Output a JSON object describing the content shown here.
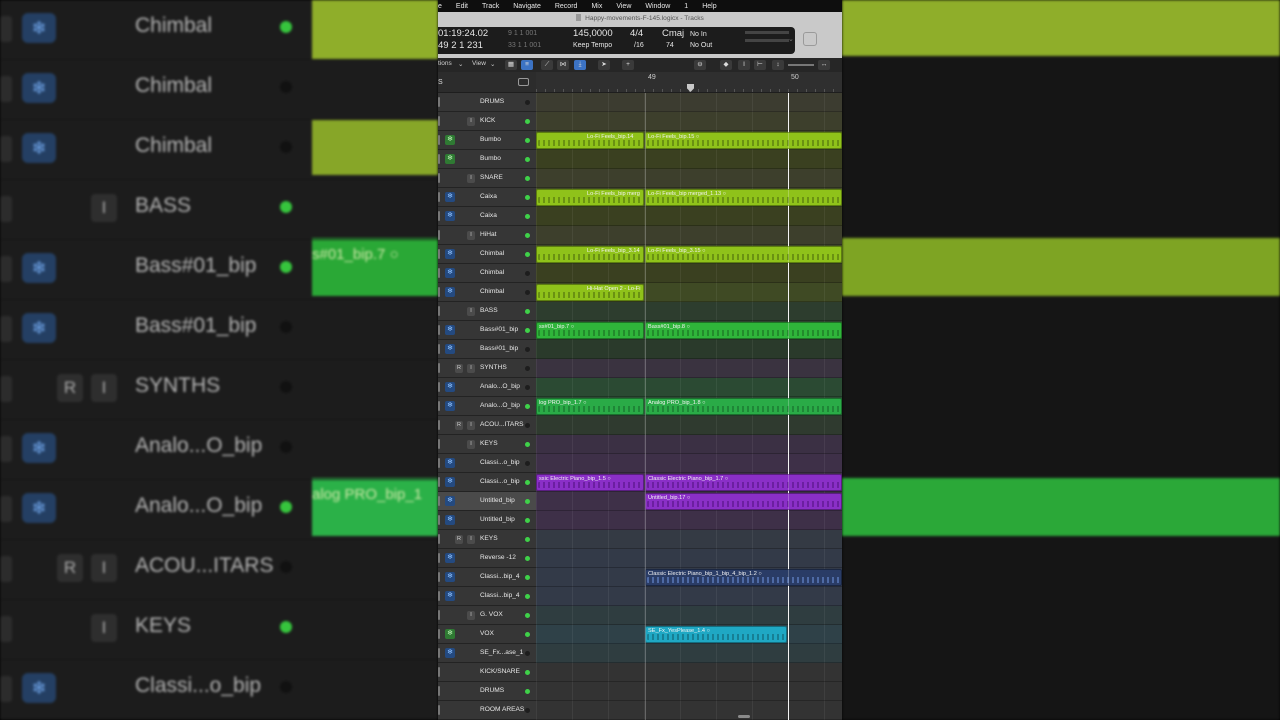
{
  "menubar": {
    "items": [
      "e",
      "Edit",
      "Track",
      "Navigate",
      "Record",
      "Mix",
      "View",
      "Window",
      "1",
      "Help"
    ]
  },
  "window": {
    "title": "Happy-movements-F-145.logicx - Tracks"
  },
  "lcd": {
    "time": "01:19:24.02",
    "time_sub": "9  1  1  001",
    "bars": "49  2  1  231",
    "bars_sub": "33  1  1  001",
    "tempo": "145,0000",
    "tempo_mode": "Keep Tempo",
    "signature": "4/4",
    "division": "/16",
    "key": "Cmaj",
    "key_value": "74",
    "input": "No In",
    "output": "No Out"
  },
  "toolbar": {
    "options_label": "tions",
    "view_label": "View"
  },
  "header": {
    "label": "S"
  },
  "ruler": {
    "bar1": "49",
    "bar2": "50"
  },
  "colors": {
    "lime": "#8fc21a",
    "green": "#2fb53a",
    "purple": "#8a2fc7",
    "navy": "#2a3c66",
    "cyan": "#1fa8c4"
  },
  "tracks": [
    {
      "name": "DRUMS",
      "type": "folder",
      "snow": false,
      "r": false,
      "i": false,
      "led": false
    },
    {
      "name": "KICK",
      "type": "folder",
      "snow": false,
      "r": false,
      "i": true,
      "led": true
    },
    {
      "name": "Bumbo",
      "type": "audio",
      "snow": "green",
      "r": false,
      "i": false,
      "led": true
    },
    {
      "name": "Bumbo",
      "type": "audio",
      "snow": "green",
      "r": false,
      "i": false,
      "led": true
    },
    {
      "name": "SNARE",
      "type": "folder",
      "snow": false,
      "r": false,
      "i": true,
      "led": true
    },
    {
      "name": "Caixa",
      "type": "audio",
      "snow": "blue",
      "r": false,
      "i": false,
      "led": true
    },
    {
      "name": "Caixa",
      "type": "audio",
      "snow": "blue",
      "r": false,
      "i": false,
      "led": true
    },
    {
      "name": "HiHat",
      "type": "folder",
      "snow": false,
      "r": false,
      "i": true,
      "led": true
    },
    {
      "name": "Chimbal",
      "type": "audio",
      "snow": "blue",
      "r": false,
      "i": false,
      "led": true
    },
    {
      "name": "Chimbal",
      "type": "audio",
      "snow": "blue",
      "r": false,
      "i": false,
      "led": false
    },
    {
      "name": "Chimbal",
      "type": "audio",
      "snow": "blue",
      "r": false,
      "i": false,
      "led": false
    },
    {
      "name": "BASS",
      "type": "folder",
      "snow": false,
      "r": false,
      "i": true,
      "led": true
    },
    {
      "name": "Bass#01_bip",
      "type": "audio",
      "snow": "blue",
      "r": false,
      "i": false,
      "led": true
    },
    {
      "name": "Bass#01_bip",
      "type": "audio",
      "snow": "blue",
      "r": false,
      "i": false,
      "led": false
    },
    {
      "name": "SYNTHS",
      "type": "folder",
      "snow": false,
      "r": true,
      "i": true,
      "led": false
    },
    {
      "name": "Analo...O_bip",
      "type": "audio",
      "snow": "blue",
      "r": false,
      "i": false,
      "led": false
    },
    {
      "name": "Analo...O_bip",
      "type": "audio",
      "snow": "blue",
      "r": false,
      "i": false,
      "led": true
    },
    {
      "name": "ACOU...ITARS",
      "type": "folder",
      "snow": false,
      "r": true,
      "i": true,
      "led": false
    },
    {
      "name": "KEYS",
      "type": "folder",
      "snow": false,
      "r": false,
      "i": true,
      "led": true
    },
    {
      "name": "Classi...o_bip",
      "type": "audio",
      "snow": "blue",
      "r": false,
      "i": false,
      "led": false
    },
    {
      "name": "Classi...o_bip",
      "type": "audio",
      "snow": "blue",
      "r": false,
      "i": false,
      "led": true
    },
    {
      "name": "Untitled_bip",
      "type": "audio",
      "snow": "blue",
      "r": false,
      "i": false,
      "led": true,
      "selected": true
    },
    {
      "name": "Untitled_bip",
      "type": "audio",
      "snow": "blue",
      "r": false,
      "i": false,
      "led": true
    },
    {
      "name": "KEYS",
      "type": "folder",
      "snow": false,
      "r": true,
      "i": true,
      "led": true
    },
    {
      "name": "Reverse -12",
      "type": "audio",
      "snow": "blue",
      "r": false,
      "i": false,
      "led": true
    },
    {
      "name": "Classi...bip_4",
      "type": "audio",
      "snow": "blue",
      "r": false,
      "i": false,
      "led": true
    },
    {
      "name": "Classi...bip_4",
      "type": "audio",
      "snow": "blue",
      "r": false,
      "i": false,
      "led": true
    },
    {
      "name": "G. VOX",
      "type": "folder",
      "snow": false,
      "r": false,
      "i": true,
      "led": true
    },
    {
      "name": "VOX",
      "type": "audio",
      "snow": "green",
      "r": false,
      "i": false,
      "led": true
    },
    {
      "name": "SE_Fx...ase_1",
      "type": "audio",
      "snow": "blue",
      "r": false,
      "i": false,
      "led": false
    },
    {
      "name": "KICK/SNARE",
      "type": "folder",
      "snow": false,
      "r": false,
      "i": false,
      "led": true
    },
    {
      "name": "DRUMS",
      "type": "folder",
      "snow": false,
      "r": false,
      "i": false,
      "led": true
    },
    {
      "name": "ROOM AREAS",
      "type": "folder",
      "snow": false,
      "r": false,
      "i": false,
      "led": false
    }
  ],
  "lanes": [
    "#3c3c30",
    "#3d3f2c",
    "#3f4a24",
    "#3a4020",
    "#3d3f2c",
    "#3f4a24",
    "#3a4020",
    "#3d3f2c",
    "#3f4a24",
    "#3a4020",
    "#3f4a24",
    "#2d3d2e",
    "#2d452e",
    "#2a3a2b",
    "#3a3340",
    "#2b4a33",
    "#2b4a33",
    "#2f3a2f",
    "#3b3044",
    "#3e3048",
    "#3e3048",
    "#3e3048",
    "#3e3048",
    "#343a44",
    "#333a48",
    "#333a48",
    "#333a48",
    "#2f3d40",
    "#2f4148",
    "#2f3d40",
    "#333",
    "#333",
    "#333"
  ],
  "regions": [
    {
      "row": 2,
      "start": 0,
      "end": 108,
      "name": "Lo-Fi Feels_bip.14",
      "color": "lime",
      "pad": 50
    },
    {
      "row": 2,
      "start": 109,
      "end": 306,
      "name": "Lo-Fi Feels_bip.15  ○",
      "color": "lime"
    },
    {
      "row": 5,
      "start": 0,
      "end": 108,
      "name": "Lo-Fi Feels_bip merg",
      "color": "lime",
      "pad": 50
    },
    {
      "row": 5,
      "start": 109,
      "end": 306,
      "name": "Lo-Fi Feels_bip merged_1.13  ○",
      "color": "lime"
    },
    {
      "row": 8,
      "start": 0,
      "end": 108,
      "name": "Lo-Fi Feels_bip_3.14",
      "color": "lime",
      "pad": 50
    },
    {
      "row": 8,
      "start": 109,
      "end": 306,
      "name": "Lo-Fi Feels_bip_3.15  ○",
      "color": "lime"
    },
    {
      "row": 10,
      "start": 0,
      "end": 108,
      "name": "Hi-Hat Open 2 - Lo-Fi",
      "color": "lime",
      "pad": 50
    },
    {
      "row": 12,
      "start": 0,
      "end": 108,
      "name": "ss#01_bip.7  ○",
      "color": "green"
    },
    {
      "row": 12,
      "start": 109,
      "end": 306,
      "name": "Bass#01_bip.8  ○",
      "color": "green"
    },
    {
      "row": 16,
      "start": 0,
      "end": 108,
      "name": "log PRO_bip_1.7  ○",
      "color": "green2"
    },
    {
      "row": 16,
      "start": 109,
      "end": 306,
      "name": "Analog PRO_bip_1.8  ○",
      "color": "green2"
    },
    {
      "row": 20,
      "start": 0,
      "end": 108,
      "name": "ssic Electric Piano_bip_1.5  ○",
      "color": "purple"
    },
    {
      "row": 20,
      "start": 109,
      "end": 306,
      "name": "Classic Electric Piano_bip_1.7  ○",
      "color": "purple"
    },
    {
      "row": 21,
      "start": 109,
      "end": 306,
      "name": "Untitled_bip.17  ○",
      "color": "purple"
    },
    {
      "row": 25,
      "start": 109,
      "end": 306,
      "name": "Classic Electric Piano_bip_1_bip_4_bip_1.2  ○",
      "color": "navy"
    },
    {
      "row": 28,
      "start": 109,
      "end": 251,
      "name": "SE_Fx_YesPlease_1.4  ○",
      "color": "cyan"
    }
  ],
  "background_left": {
    "rows": [
      {
        "name": "Chimbal",
        "snow": true,
        "led": true
      },
      {
        "name": "Chimbal",
        "snow": true,
        "led": false
      },
      {
        "name": "Chimbal",
        "snow": true,
        "led": false
      },
      {
        "name": "BASS",
        "snow": false,
        "i": true,
        "led": true
      },
      {
        "name": "Bass#01_bip",
        "snow": true,
        "led": true
      },
      {
        "name": "Bass#01_bip",
        "snow": true,
        "led": false
      },
      {
        "name": "SYNTHS",
        "snow": false,
        "r": true,
        "i": true,
        "led": false
      },
      {
        "name": "Analo...O_bip",
        "snow": true,
        "led": false
      },
      {
        "name": "Analo...O_bip",
        "snow": true,
        "led": true
      },
      {
        "name": "ACOU...ITARS",
        "snow": false,
        "r": true,
        "i": true,
        "led": false
      },
      {
        "name": "KEYS",
        "snow": false,
        "i": true,
        "led": true
      },
      {
        "name": "Classi...o_bip",
        "snow": true,
        "led": false
      }
    ],
    "region_texts": [
      "s#01_bip.7  ○",
      "alog PRO_bip_1"
    ]
  }
}
